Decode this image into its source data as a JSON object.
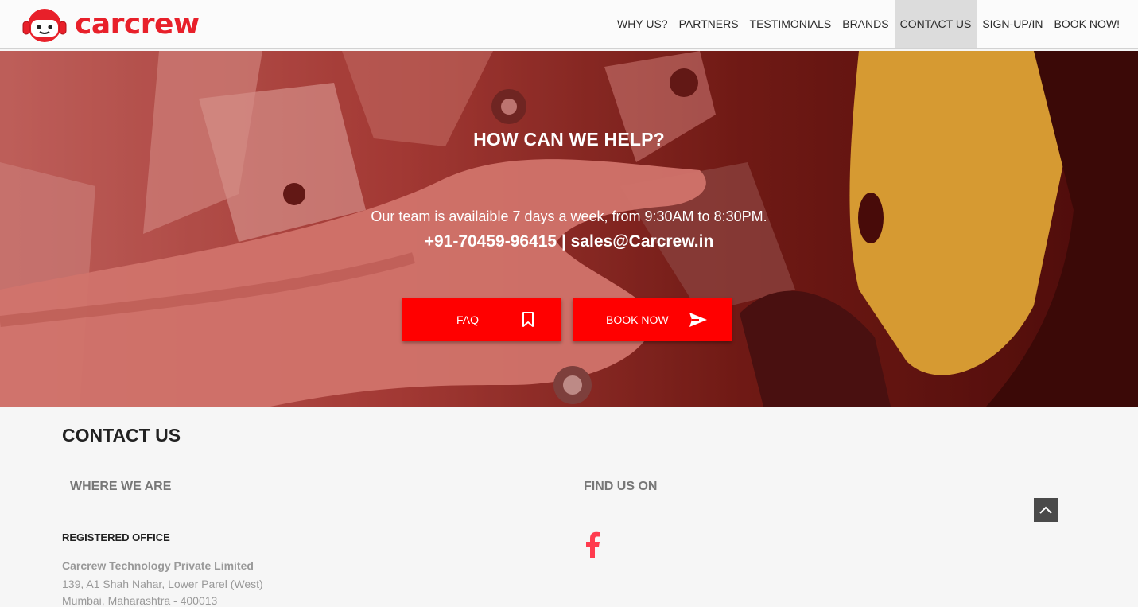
{
  "brand": {
    "name": "carcrew",
    "color": "#e8202a"
  },
  "nav": {
    "items": [
      {
        "label": "WHY US?"
      },
      {
        "label": "PARTNERS"
      },
      {
        "label": "TESTIMONIALS"
      },
      {
        "label": "BRANDS"
      },
      {
        "label": "CONTACT US",
        "active": true
      },
      {
        "label": "SIGN-UP/IN"
      },
      {
        "label": "BOOK NOW!"
      }
    ]
  },
  "hero": {
    "title": "HOW CAN WE HELP?",
    "subtitle": "Our team is availaible 7 days a week, from 9:30AM to 8:30PM.",
    "contact": "+91-70459-96415 | sales@Carcrew.in",
    "faq_button": {
      "label": "FAQ",
      "icon": "bookmark-icon"
    },
    "book_button": {
      "label": "BOOK NOW",
      "icon": "send-icon"
    },
    "button_color": "#ff0000"
  },
  "contact": {
    "title": "CONTACT US",
    "where_heading": "WHERE WE ARE",
    "find_heading": "FIND US ON",
    "registered_label": "REGISTERED OFFICE",
    "company_name": "Carcrew Technology Private Limited",
    "address_line1": "139, A1 Shah Nahar, Lower Parel (West)",
    "address_line2": "Mumbai, Maharashtra - 400013",
    "social": [
      {
        "icon": "facebook-icon",
        "color": "#ff3b4e"
      }
    ]
  },
  "scroll_top": {
    "icon": "chevron-up-icon"
  }
}
